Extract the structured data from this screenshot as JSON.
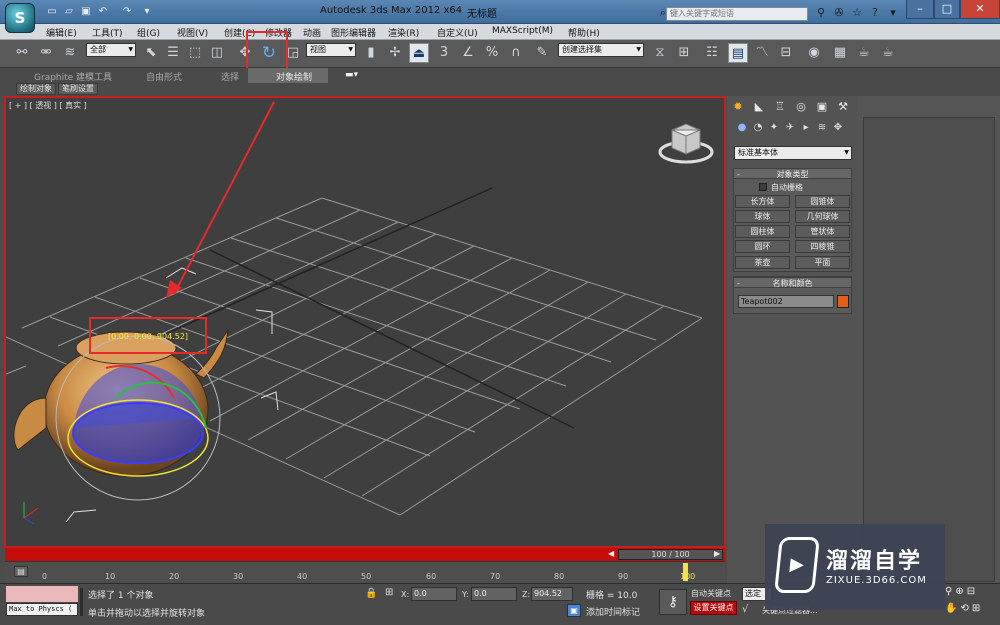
{
  "window": {
    "app_title": "Autodesk 3ds Max  2012 x64",
    "doc_title": "无标题",
    "search_placeholder": "键入关键字或短语",
    "app_logo": "S",
    "min": "–",
    "max": "□",
    "close": "✕"
  },
  "menu": [
    "编辑(E)",
    "工具(T)",
    "组(G)",
    "视图(V)",
    "创建(C)",
    "修改器",
    "动画",
    "图形编辑器",
    "渲染(R)",
    "自定义(U)",
    "MAXScript(M)",
    "帮助(H)"
  ],
  "toolbar": {
    "selection_filter": "全部",
    "ref_coord": "视图",
    "named_sel": "创建选择集",
    "snap_label": "3",
    "pct_label": "%"
  },
  "ribbon": {
    "tabs": [
      "Graphite 建模工具",
      "自由形式",
      "选择",
      "对象绘制"
    ],
    "active": "对象绘制",
    "sub": [
      "绘制对象",
      "笔刷设置"
    ]
  },
  "viewport": {
    "label": "[ + ] [ 透视 ] [ 真实 ]",
    "coords": "[0.00, 0.00, 904.52]"
  },
  "timeline": {
    "slider": "100 / 100",
    "ticks": [
      "0",
      "10",
      "20",
      "30",
      "40",
      "50",
      "60",
      "70",
      "80",
      "90",
      "100"
    ]
  },
  "command_panel": {
    "category": "标准基本体",
    "object_type_title": "对象类型",
    "autogrid": "自动栅格",
    "buttons": [
      "长方体",
      "圆锥体",
      "球体",
      "几何球体",
      "圆柱体",
      "管状体",
      "圆环",
      "四棱锥",
      "茶壶",
      "平面"
    ],
    "name_color_title": "名称和颜色",
    "object_name": "Teapot002",
    "object_color": "#e35e14"
  },
  "status": {
    "max_to_physics": "Max to Physcs (",
    "line1": "选择了 1 个对象",
    "line2": "单击并拖动以选择并旋转对象",
    "x_label": "X:",
    "x": "0.0",
    "y_label": "Y:",
    "y": "0.0",
    "z_label": "Z:",
    "z": "904.52",
    "grid": "栅格 = 10.0",
    "add_time_tag": "添加时间标记",
    "auto_key": "自动关键点",
    "set_key": "设置关键点",
    "selected": "选定",
    "key_filters": "关键点过滤器..."
  },
  "watermark": {
    "brand": "溜溜自学",
    "url": "ZIXUE.3D66.COM"
  },
  "colors": {
    "accent_red": "#e52a2a",
    "titlebar": "#4a79a8",
    "timeline_red": "#c30d0d"
  }
}
